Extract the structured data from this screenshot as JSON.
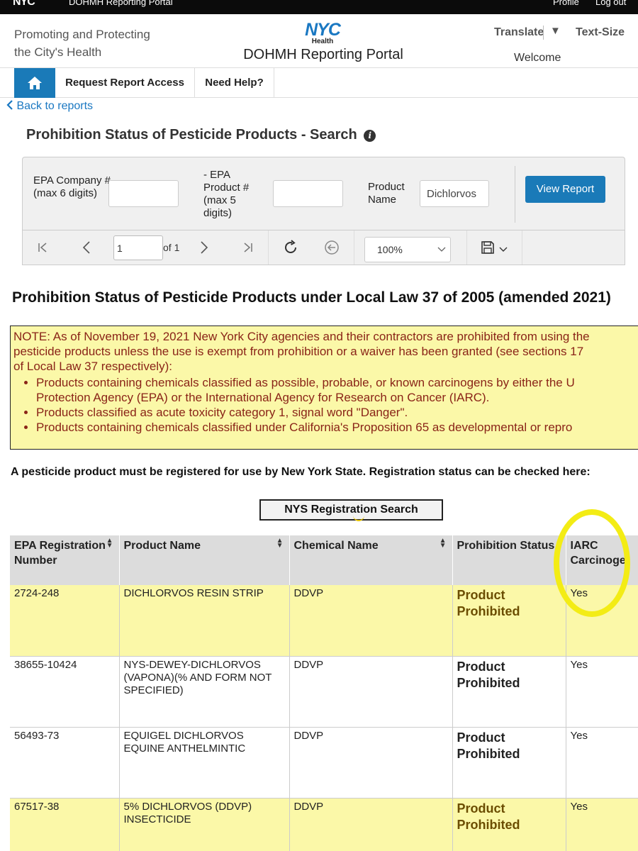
{
  "topbar": {
    "portal": "DOHMH Reporting Portal",
    "profile": "Profile",
    "logout": "Log out"
  },
  "header": {
    "tagline_line1": "Promoting and Protecting",
    "tagline_line2": "the City's Health",
    "logo_nyc": "NYC",
    "logo_health": "Health",
    "portal_title": "DOHMH Reporting Portal",
    "translate": "Translate",
    "translate_caret": "▼",
    "text_size": "Text-Size",
    "welcome": "Welcome"
  },
  "nav": {
    "home_icon": "home-icon",
    "request_access": "Request Report Access",
    "need_help": "Need Help?"
  },
  "back_link": "Back to reports",
  "page_heading": "Prohibition Status of Pesticide Products - Search",
  "info_icon_glyph": "i",
  "params": {
    "company_label": "EPA Company # (max 6 digits)",
    "company_value": "",
    "product_num_label": "- EPA Product # (max 5 digits)",
    "product_num_value": "",
    "product_name_label": "Product Name",
    "product_name_value": "Dichlorvos",
    "view_report": "View Report"
  },
  "toolbar": {
    "page": "1",
    "of_label": "of 1",
    "zoom": "100%"
  },
  "report_title": "Prohibition Status of Pesticide Products under Local Law 37 of 2005 (amended 2021)",
  "note": {
    "line1": "NOTE: As of November 19, 2021 New York City agencies and their contractors are prohibited from using the",
    "line2": "pesticide products unless the use is exempt from prohibition or a waiver has been granted (see sections 17",
    "line3": "of Local Law 37 respectively):",
    "bullet1_a": "Products containing chemicals classified as possible, probable, or known carcinogens by either the U",
    "bullet1_b": "Protection Agency (EPA) or the International Agency for Research on Cancer (IARC).",
    "bullet2": "Products classified as acute toxicity category 1, signal word \"Danger\".",
    "bullet3": "Products containing chemicals classified under California's Proposition 65 as developmental or repro"
  },
  "registration_note": "A pesticide product must be registered for use by New York State. Registration status can be checked here:",
  "nys_button": "NYS Registration Search",
  "table": {
    "headers": [
      "EPA Registration Number",
      "Product Name",
      "Chemical Name",
      "Prohibition Status",
      "IARC Carcinoge"
    ],
    "rows": [
      {
        "reg": "2724-248",
        "product": "DICHLORVOS RESIN STRIP",
        "chemical": "DDVP",
        "status": "Product Prohibited",
        "iarc": "Yes"
      },
      {
        "reg": "38655-10424",
        "product": "NYS-DEWEY-DICHLORVOS (VAPONA)(% AND FORM NOT SPECIFIED)",
        "chemical": "DDVP",
        "status": "Product Prohibited",
        "iarc": "Yes"
      },
      {
        "reg": "56493-73",
        "product": "EQUIGEL DICHLORVOS EQUINE ANTHELMINTIC",
        "chemical": "DDVP",
        "status": "Product Prohibited",
        "iarc": "Yes"
      },
      {
        "reg": "67517-38",
        "product": "5% DICHLORVOS (DDVP) INSECTICIDE",
        "chemical": "DDVP",
        "status": "Product Prohibited",
        "iarc": "Yes"
      }
    ]
  },
  "colors": {
    "accent": "#1a7ab8",
    "highlight": "#fbf8a8",
    "note_text": "#8a2418",
    "circle": "#f3ec15"
  }
}
